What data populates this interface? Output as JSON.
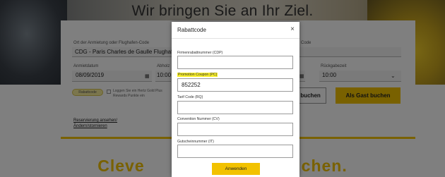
{
  "page": {
    "hero_title": "Wir bringen Sie an Ihr Ziel.",
    "bottom_banner_left": "Cleve",
    "bottom_banner_right": "uchen."
  },
  "booking": {
    "location_label": "Ort der Anmietung oder Flughafen-Code",
    "location_value": "CDG - Paris Charles de Gaulle Flughafe",
    "return_code_label": "Code",
    "pickup_date_label": "Anmietdatum",
    "pickup_date_value": "08/09/2019",
    "pickup_time_label": "Abholz",
    "pickup_time_value": "10:00",
    "return_time_label": "Rückgabezeit",
    "return_time_value": "10:00",
    "rabatt_badge": "Rabattcode",
    "member_text": "Loggen Sie ein Hertz Gold Plus Rewards Punkte ein",
    "link_reservation": "Reservierung ansehen/",
    "link_change": "Ändern/stornieren",
    "book_label": "d buchen",
    "guest_book_label": "Als Gast buchen"
  },
  "modal": {
    "title": "Rabattcode",
    "close_glyph": "×",
    "fields": [
      {
        "label": "Firmenrabattnummer (CDP)",
        "value": ""
      },
      {
        "label": "Promotion Coupon (PC)",
        "value": "852252"
      },
      {
        "label": "Tarif Code (RQ)",
        "value": ""
      },
      {
        "label": "Convention Nummer (CV)",
        "value": ""
      },
      {
        "label": "Gutscheinnummer (IT)",
        "value": ""
      }
    ],
    "apply_label": "Anwenden"
  },
  "colors": {
    "accent": "#f2c200",
    "highlight": "#f7ee2a",
    "overlay": "rgba(0,0,0,0.5)"
  }
}
